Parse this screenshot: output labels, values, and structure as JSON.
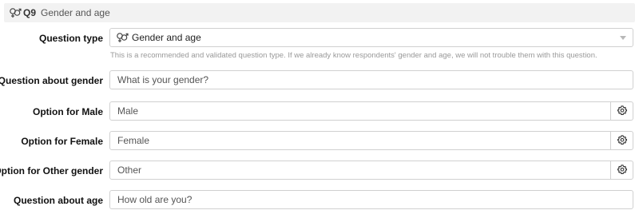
{
  "header": {
    "icon": "gender-icon",
    "number": "Q9",
    "title": "Gender and age"
  },
  "question_type": {
    "label": "Question type",
    "value": "Gender and age",
    "icon": "gender-icon",
    "hint": "This is a recommended and validated question type. If we already know respondents' gender and age, we will not trouble them with this question."
  },
  "question_gender": {
    "label": "Question about gender",
    "value": "What is your gender?"
  },
  "option_male": {
    "label": "Option for Male",
    "value": "Male",
    "button_icon": "gear-icon"
  },
  "option_female": {
    "label": "Option for Female",
    "value": "Female",
    "button_icon": "gear-icon"
  },
  "option_other": {
    "label": "Option for Other gender",
    "value": "Other",
    "button_icon": "gear-icon"
  },
  "question_age": {
    "label": "Question about age",
    "value": "How old are you?"
  },
  "colors": {
    "header_bg": "#f2f2f2",
    "border": "#d0d0d0",
    "hint_text": "#999999"
  }
}
